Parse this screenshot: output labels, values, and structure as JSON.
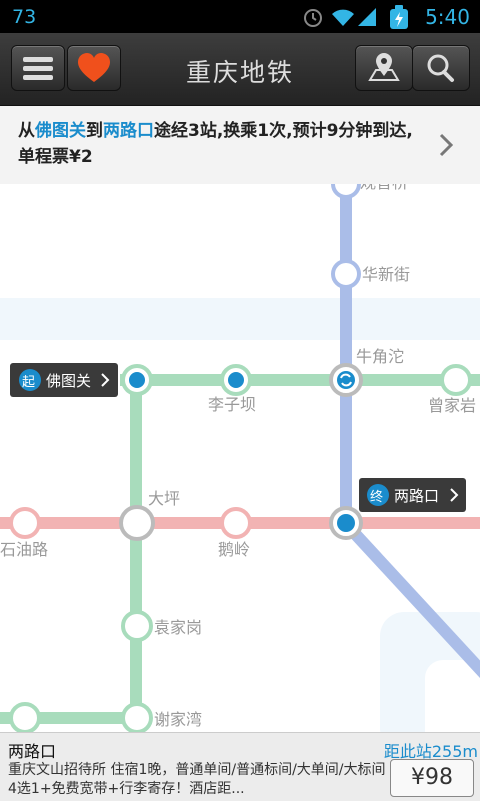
{
  "status_bar": {
    "left_text": "73",
    "time": "5:40"
  },
  "header": {
    "title": "重庆地铁"
  },
  "route_summary": {
    "prefix": "从",
    "from": "佛图关",
    "mid": "到",
    "to": "两路口",
    "rest": "途经3站,换乘1次,预计9分钟到达,单程票¥2"
  },
  "map": {
    "stations": {
      "top_partial": "观音桥",
      "huaxinjie": "华新街",
      "niujiaotuo": "牛角沱",
      "lizixi": "李子坝",
      "zengjiayan": "曾家岩",
      "daping": "大坪",
      "shiyoulu": "石油路",
      "eling": "鹅岭",
      "yuanjiagang": "袁家岗",
      "xiejiawan": "谢家湾"
    },
    "start_tag": {
      "badge": "起",
      "label": "佛图关"
    },
    "end_tag": {
      "badge": "终",
      "label": "两路口"
    },
    "line_colors": {
      "green": "#a8dcbc",
      "blue": "#aabde8",
      "red": "#f2b3b3"
    }
  },
  "bottom_ad": {
    "station": "两路口",
    "distance": "距此站255m",
    "description": "重庆文山招待所 住宿1晚，普通单间/普通标间/大单间/大标间4选1+免费宽带+行李寄存！酒店距...",
    "price": "¥98"
  }
}
